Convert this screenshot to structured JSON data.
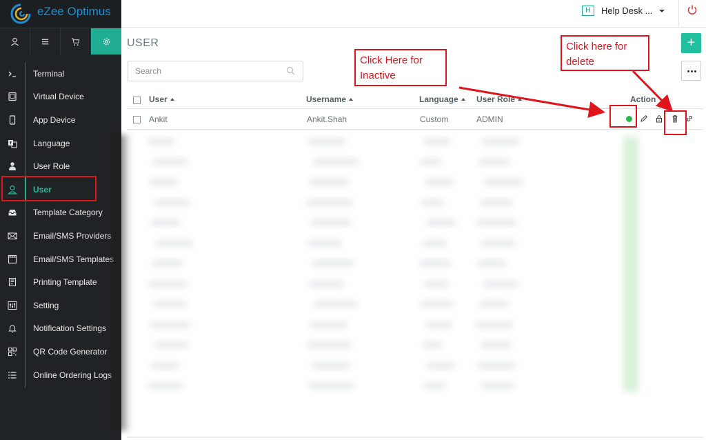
{
  "app": {
    "logo_text": "eZee Optimus",
    "help_badge": "H",
    "help_label": "Help Desk ...",
    "power_icon": "power-icon"
  },
  "top_tabs": [
    {
      "name": "user-icon",
      "active": false
    },
    {
      "name": "menu-icon",
      "active": false
    },
    {
      "name": "cart-icon",
      "active": false
    },
    {
      "name": "gear-icon",
      "active": true
    }
  ],
  "sidebar": {
    "items": [
      {
        "label": "Terminal",
        "icon": "terminal-icon",
        "active": false
      },
      {
        "label": "Virtual Device",
        "icon": "tablet-icon",
        "active": false
      },
      {
        "label": "App Device",
        "icon": "mobile-icon",
        "active": false
      },
      {
        "label": "Language",
        "icon": "language-icon",
        "active": false
      },
      {
        "label": "User Role",
        "icon": "person-icon",
        "active": false
      },
      {
        "label": "User",
        "icon": "user-outline-icon",
        "active": true
      },
      {
        "label": "Template Category",
        "icon": "inbox-icon",
        "active": false
      },
      {
        "label": "Email/SMS Providers",
        "icon": "envelope-icon",
        "active": false
      },
      {
        "label": "Email/SMS Templates",
        "icon": "template-icon",
        "active": false
      },
      {
        "label": "Printing Template",
        "icon": "receipt-icon",
        "active": false
      },
      {
        "label": "Setting",
        "icon": "sliders-icon",
        "active": false
      },
      {
        "label": "Notification Settings",
        "icon": "bell-icon",
        "active": false
      },
      {
        "label": "QR Code Generator",
        "icon": "qr-icon",
        "active": false
      },
      {
        "label": "Online Ordering Logs",
        "icon": "list-icon",
        "active": false
      }
    ]
  },
  "main": {
    "title": "USER",
    "add_label": "+",
    "search_placeholder": "Search",
    "columns": {
      "user": "User",
      "username": "Username",
      "language": "Language",
      "user_role": "User Role",
      "action": "Action"
    },
    "rows": [
      {
        "user": "Ankit",
        "username": "Ankit.Shah",
        "language": "Custom",
        "user_role": "ADMIN",
        "status": "active"
      }
    ]
  },
  "annotations": {
    "inactive": "Click Here for Inactive",
    "delete": "Click here for delete"
  },
  "colors": {
    "accent": "#1fae93",
    "sidebar_bg": "#202325",
    "annotation": "#e0141b",
    "status_active": "#2db84a"
  }
}
